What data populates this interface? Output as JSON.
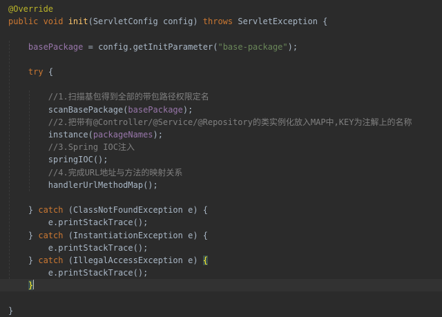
{
  "editor": {
    "colors": {
      "background": "#2b2b2b",
      "current_line": "#323232",
      "plain": "#a9b7c6",
      "keyword": "#cc7832",
      "annotation": "#bbb529",
      "method_declaration": "#ffc66d",
      "field": "#9876aa",
      "string": "#6a8759",
      "comment": "#808080",
      "matched_brace": "#ffef28"
    },
    "lines": [
      {
        "tokens": [
          {
            "t": "annotation",
            "v": "@Override"
          }
        ]
      },
      {
        "tokens": [
          {
            "t": "keyword",
            "v": "public void "
          },
          {
            "t": "method-decl",
            "v": "init"
          },
          {
            "t": "plain",
            "v": "(ServletConfig config) "
          },
          {
            "t": "keyword",
            "v": "throws "
          },
          {
            "t": "plain",
            "v": "ServletException {"
          }
        ]
      },
      {
        "tokens": []
      },
      {
        "tokens": [
          {
            "t": "plain",
            "v": "    "
          },
          {
            "t": "field",
            "v": "basePackage"
          },
          {
            "t": "plain",
            "v": " = config.getInitParameter("
          },
          {
            "t": "string",
            "v": "\"base-package\""
          },
          {
            "t": "plain",
            "v": ");"
          }
        ]
      },
      {
        "tokens": []
      },
      {
        "tokens": [
          {
            "t": "plain",
            "v": "    "
          },
          {
            "t": "keyword",
            "v": "try "
          },
          {
            "t": "plain",
            "v": "{"
          }
        ]
      },
      {
        "tokens": []
      },
      {
        "tokens": [
          {
            "t": "plain",
            "v": "        "
          },
          {
            "t": "comment",
            "v": "//1.扫描基包得到全部的带包路径权限定名"
          }
        ]
      },
      {
        "tokens": [
          {
            "t": "plain",
            "v": "        scanBasePackage("
          },
          {
            "t": "field",
            "v": "basePackage"
          },
          {
            "t": "plain",
            "v": ");"
          }
        ]
      },
      {
        "tokens": [
          {
            "t": "plain",
            "v": "        "
          },
          {
            "t": "comment",
            "v": "//2.把带有@Controller/@Service/@Repository的类实例化放入MAP中,KEY为注解上的名称"
          }
        ]
      },
      {
        "tokens": [
          {
            "t": "plain",
            "v": "        instance("
          },
          {
            "t": "field",
            "v": "packageNames"
          },
          {
            "t": "plain",
            "v": ");"
          }
        ]
      },
      {
        "tokens": [
          {
            "t": "plain",
            "v": "        "
          },
          {
            "t": "comment",
            "v": "//3.Spring IOC注入"
          }
        ]
      },
      {
        "tokens": [
          {
            "t": "plain",
            "v": "        springIOC();"
          }
        ]
      },
      {
        "tokens": [
          {
            "t": "plain",
            "v": "        "
          },
          {
            "t": "comment",
            "v": "//4.完成URL地址与方法的映射关系"
          }
        ]
      },
      {
        "tokens": [
          {
            "t": "plain",
            "v": "        handlerUrlMethodMap();"
          }
        ]
      },
      {
        "tokens": []
      },
      {
        "tokens": [
          {
            "t": "plain",
            "v": "    } "
          },
          {
            "t": "keyword",
            "v": "catch "
          },
          {
            "t": "plain",
            "v": "(ClassNotFoundException e) {"
          }
        ]
      },
      {
        "tokens": [
          {
            "t": "plain",
            "v": "        e.printStackTrace();"
          }
        ]
      },
      {
        "tokens": [
          {
            "t": "plain",
            "v": "    } "
          },
          {
            "t": "keyword",
            "v": "catch "
          },
          {
            "t": "plain",
            "v": "(InstantiationException e) {"
          }
        ]
      },
      {
        "tokens": [
          {
            "t": "plain",
            "v": "        e.printStackTrace();"
          }
        ]
      },
      {
        "tokens": [
          {
            "t": "plain",
            "v": "    } "
          },
          {
            "t": "keyword",
            "v": "catch "
          },
          {
            "t": "plain",
            "v": "(IllegalAccessException e) "
          },
          {
            "t": "brace-match",
            "v": "{"
          }
        ]
      },
      {
        "tokens": [
          {
            "t": "plain",
            "v": "        e.printStackTrace();"
          }
        ]
      },
      {
        "current": true,
        "caret_after": true,
        "tokens": [
          {
            "t": "plain",
            "v": "    "
          },
          {
            "t": "brace-match",
            "v": "}"
          }
        ]
      },
      {
        "tokens": []
      },
      {
        "tokens": [
          {
            "t": "plain",
            "v": "}"
          }
        ]
      }
    ]
  }
}
